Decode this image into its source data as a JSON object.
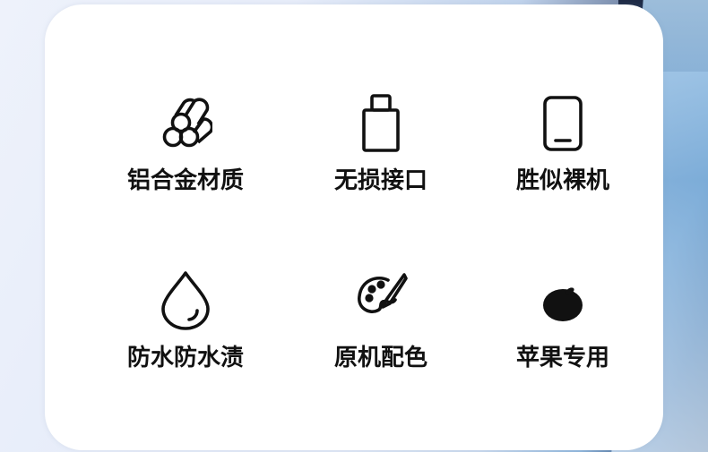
{
  "features": [
    {
      "label": "铝合金材质",
      "icon": "aluminum-pipes-icon"
    },
    {
      "label": "无损接口",
      "icon": "connector-port-icon"
    },
    {
      "label": "胜似裸机",
      "icon": "phone-outline-icon"
    },
    {
      "label": "防水防水渍",
      "icon": "water-drop-icon"
    },
    {
      "label": "原机配色",
      "icon": "palette-brush-icon"
    },
    {
      "label": "苹果专用",
      "icon": "apple-logo-icon"
    }
  ],
  "colors": {
    "card_background": "#ffffff",
    "text": "#111111",
    "icon_stroke": "#111111"
  }
}
